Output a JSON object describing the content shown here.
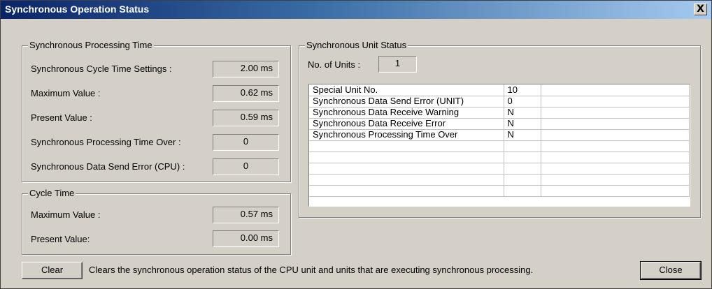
{
  "window": {
    "title": "Synchronous Operation Status",
    "close_glyph": "X"
  },
  "sync_processing_time": {
    "legend": "Synchronous Processing Time",
    "rows": [
      {
        "label": "Synchronous Cycle Time Settings :",
        "value": "2.00 ms"
      },
      {
        "label": "Maximum Value :",
        "value": "0.62 ms"
      },
      {
        "label": "Present Value :",
        "value": "0.59 ms"
      },
      {
        "label": "Synchronous Processing Time Over :",
        "value": "0"
      },
      {
        "label": "Synchronous Data Send Error (CPU) :",
        "value": "0"
      }
    ]
  },
  "cycle_time": {
    "legend": "Cycle Time",
    "rows": [
      {
        "label": "Maximum Value :",
        "value": "0.57 ms"
      },
      {
        "label": "Present Value:",
        "value": "0.00 ms"
      }
    ]
  },
  "sync_unit_status": {
    "legend": "Synchronous Unit Status",
    "units_label": "No. of Units :",
    "units_value": "1",
    "table": [
      [
        "Special Unit No.",
        "10",
        ""
      ],
      [
        "Synchronous Data Send Error (UNIT)",
        "0",
        ""
      ],
      [
        "Synchronous Data Receive Warning",
        "N",
        ""
      ],
      [
        "Synchronous Data Receive Error",
        "N",
        ""
      ],
      [
        "Synchronous Processing Time Over",
        "N",
        ""
      ],
      [
        "",
        "",
        ""
      ],
      [
        "",
        "",
        ""
      ],
      [
        "",
        "",
        ""
      ],
      [
        "",
        "",
        ""
      ],
      [
        "",
        "",
        ""
      ]
    ]
  },
  "footer": {
    "clear_label": "Clear",
    "clear_description": "Clears the synchronous operation status of the CPU unit and units that are executing synchronous processing.",
    "close_label": "Close"
  }
}
